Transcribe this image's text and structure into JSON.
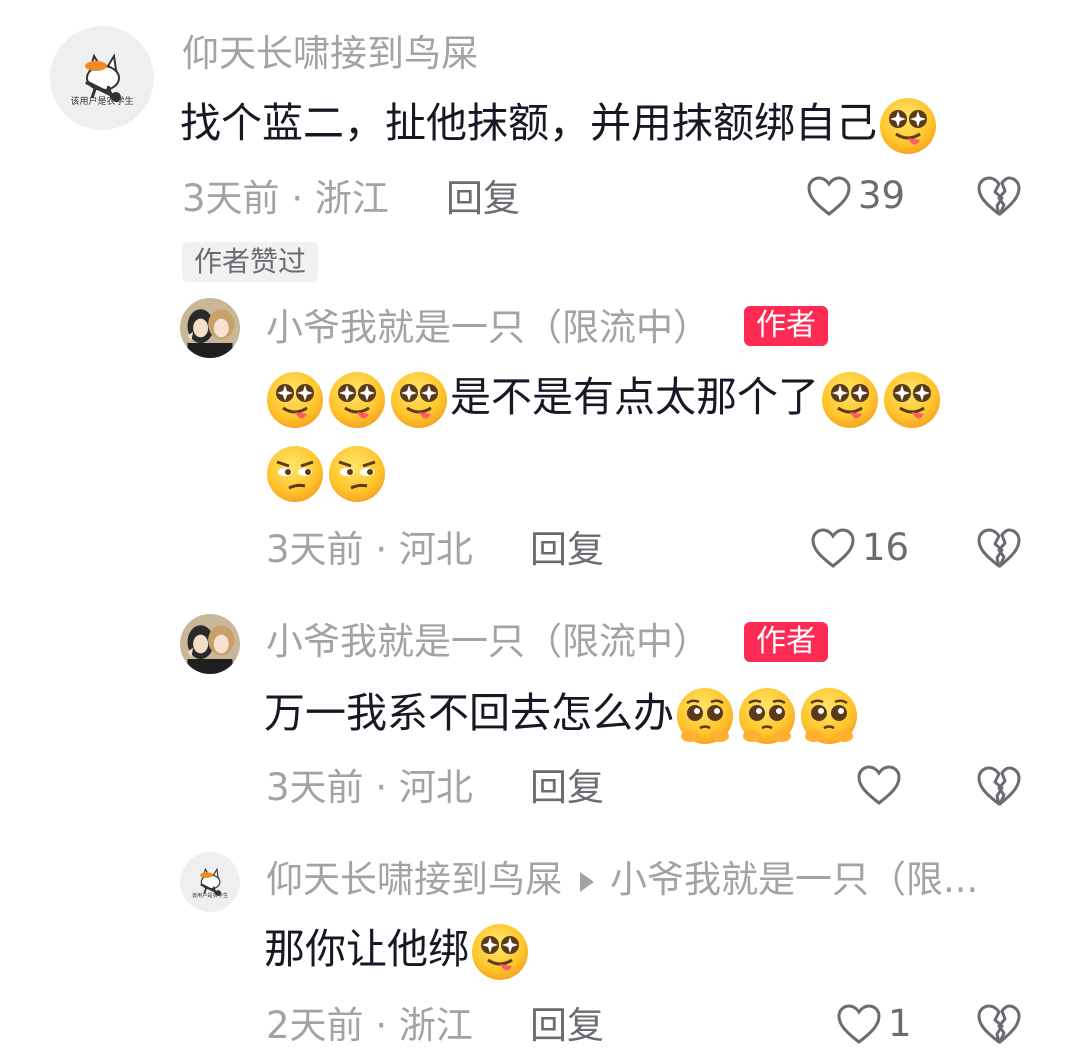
{
  "comment": {
    "user": "仰天长啸接到鸟屎",
    "avatar_caption": "该用户是农学生",
    "text": "找个蓝二，扯他抹额，并用抹额绑自己",
    "time": "3天前",
    "location": "浙江",
    "reply_label": "回复",
    "likes": "39",
    "author_liked_tag": "作者赞过"
  },
  "replies": [
    {
      "user": "小爷我就是一只（限流中）",
      "badge": "作者",
      "text": "是不是有点太那个了",
      "time": "3天前",
      "location": "河北",
      "reply_label": "回复",
      "likes": "16"
    },
    {
      "user": "小爷我就是一只（限流中）",
      "badge": "作者",
      "text": "万一我系不回去怎么办",
      "time": "3天前",
      "location": "河北",
      "reply_label": "回复",
      "likes": ""
    },
    {
      "user": "仰天长啸接到鸟屎",
      "avatar_caption": "该用户是农学生",
      "reply_to": "小爷我就是一只（限...",
      "text": "那你让他绑",
      "time": "2天前",
      "location": "浙江",
      "reply_label": "回复",
      "likes": "1"
    }
  ],
  "separator": "·",
  "colors": {
    "accent": "#fe2c55",
    "muted": "#a2a3a7",
    "text": "#161823"
  },
  "icons": [
    "heart-outline-icon",
    "broken-heart-icon",
    "drooling-emoji",
    "smirk-emoji",
    "pleading-emoji"
  ]
}
